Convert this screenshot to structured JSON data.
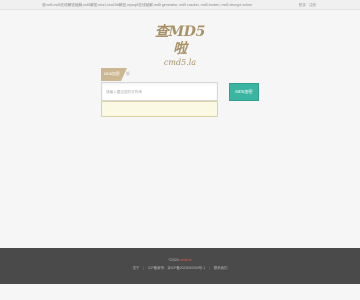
{
  "topbar": {
    "description": "查md5,md5在线解密破解,md5解密,sha1,sha256解密,mysql5在线破解,md5 generator, md5 cracker, md5 broken, md5 decrypt online",
    "links": [
      "登录",
      "注册"
    ]
  },
  "logo": {
    "main": "查MD5啦",
    "sub": "cmd5.la"
  },
  "tabs": {
    "active": "MD5加密",
    "inactive": "解密"
  },
  "search": {
    "placeholder": "请输入要加密的字符串",
    "value": ""
  },
  "submit_label": "MD5加密",
  "footer": {
    "row1_prefix": "©2024",
    "row1_highlight": "cmd5.la",
    "row1_suffix": "",
    "row2_items": [
      "关于",
      "ICP备案号：京ICP备2023000000号-1",
      "联系我们"
    ]
  },
  "colors": {
    "accent": "#3bb5a1",
    "tab": "#cbb892",
    "footer": "#4a4a4a",
    "result_bg": "#fbf9e3"
  }
}
